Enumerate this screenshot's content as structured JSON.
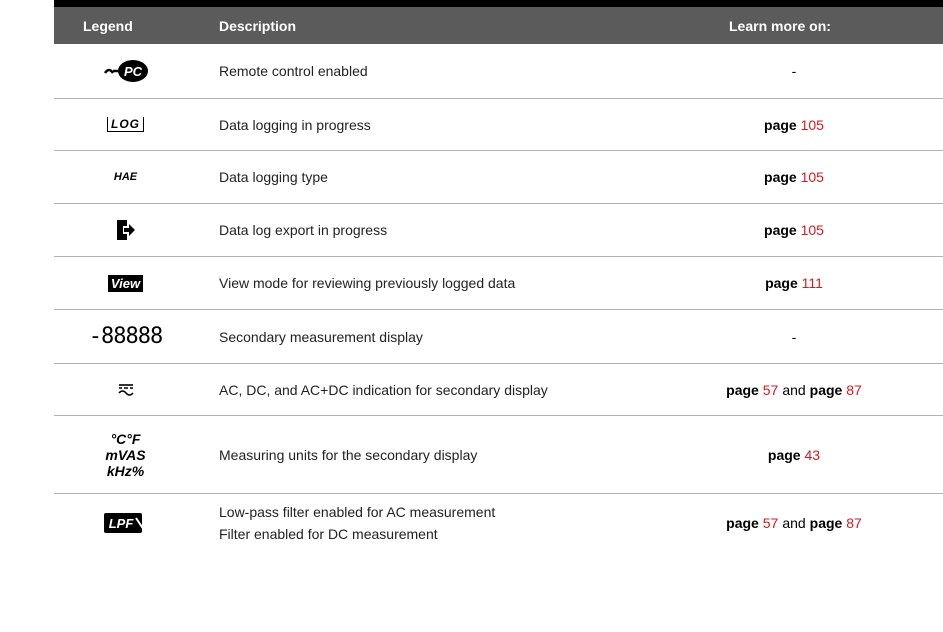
{
  "header": {
    "legend": "Legend",
    "description": "Description",
    "learn_more": "Learn more on:"
  },
  "rows": [
    {
      "icon": "remote-pc-icon",
      "description": "Remote control enabled",
      "learn_more": "-"
    },
    {
      "icon": "log-icon",
      "icon_text": "LOG",
      "description": "Data logging in progress",
      "page_word": "page",
      "page": "105"
    },
    {
      "icon": "hae-icon",
      "icon_text": "HAE",
      "description": "Data logging type",
      "page_word": "page",
      "page": "105"
    },
    {
      "icon": "export-icon",
      "description": "Data log export in progress",
      "page_word": "page",
      "page": "105"
    },
    {
      "icon": "view-icon",
      "icon_text": "View",
      "description": "View mode for reviewing previously logged data",
      "page_word": "page",
      "page": "111"
    },
    {
      "icon": "seven-segment-icon",
      "icon_text": "-88888",
      "description": "Secondary measurement display",
      "learn_more": "-"
    },
    {
      "icon": "acdc-icon",
      "description": "AC, DC, and AC+DC indication for secondary display",
      "page_word": "page",
      "page": "57",
      "and": "and",
      "page_word2": "page",
      "page2": "87"
    },
    {
      "icon": "units-icon",
      "icon_lines": [
        "°C°F",
        "mVAS",
        "kHz%"
      ],
      "description": "Measuring units for the secondary display",
      "page_word": "page",
      "page": "43"
    },
    {
      "icon": "lpf-icon",
      "icon_text": "LPF",
      "description_lines": [
        "Low-pass filter enabled for AC measurement",
        "Filter enabled for DC measurement"
      ],
      "page_word": "page",
      "page": "57",
      "and": "and",
      "page_word2": "page",
      "page2": "87"
    }
  ]
}
